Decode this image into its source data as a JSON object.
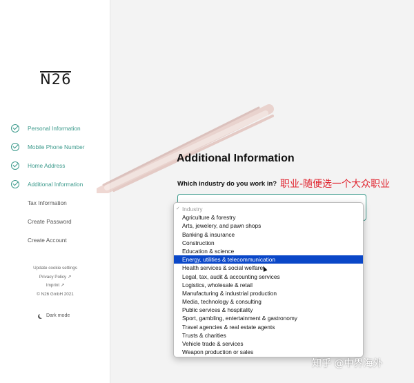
{
  "sidebar": {
    "logo": "N26",
    "steps": [
      {
        "label": "Personal Information",
        "done": true
      },
      {
        "label": "Mobile Phone Number",
        "done": true
      },
      {
        "label": "Home Address",
        "done": true
      },
      {
        "label": "Additional Information",
        "done": true
      },
      {
        "label": "Tax Information",
        "done": false
      },
      {
        "label": "Create Password",
        "done": false
      },
      {
        "label": "Create Account",
        "done": false
      }
    ],
    "footer": {
      "cookie": "Update cookie settings",
      "privacy": "Privacy Policy ↗",
      "imprint": "Imprint ↗",
      "copyright": "© N26 GmbH 2021",
      "dark_mode": "Dark mode"
    }
  },
  "main": {
    "title": "Additional Information",
    "question": "Which industry do you work in?",
    "annotation": "职业-随便选一个大众职业",
    "dropdown": {
      "placeholder": "Industry",
      "selected_index": 6,
      "options": [
        "Agriculture & forestry",
        "Arts, jewelery, and pawn shops",
        "Banking & insurance",
        "Construction",
        "Education & science",
        "Energy, utilities & telecommunication",
        "Health services & social welfare",
        "Legal, tax, audit & accounting services",
        "Logistics, wholesale & retail",
        "Manufacturing & industrial production",
        "Media, technology & consulting",
        "Public services & hospitality",
        "Sport, gambling, entertainment & gastronomy",
        "Travel agencies & real estate agents",
        "Trusts & charities",
        "Vehicle trade & services",
        "Weapon production or sales"
      ]
    }
  },
  "watermark": "知乎 @中界海外",
  "colors": {
    "accent": "#3c9a8c",
    "selection": "#0a47c8",
    "annotation": "#e0232e"
  }
}
